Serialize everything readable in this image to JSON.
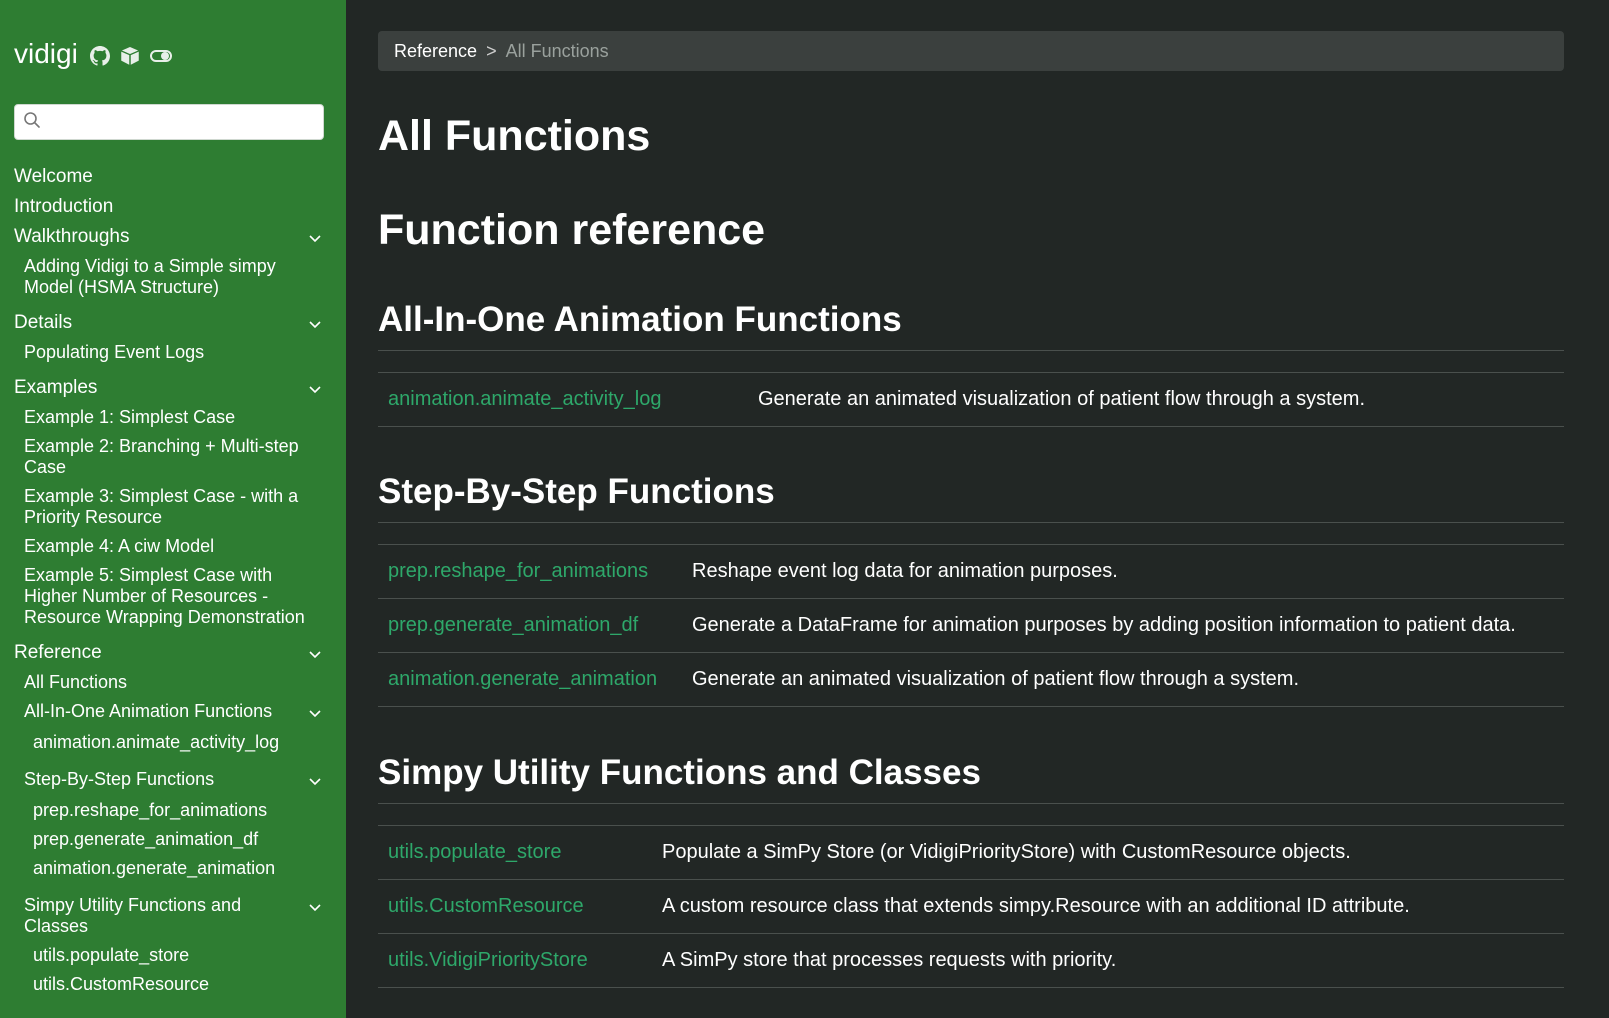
{
  "sidebar": {
    "brand": "vidigi",
    "icons": [
      "github-icon",
      "package-icon",
      "toggle-icon"
    ],
    "search": {
      "value": "",
      "placeholder": ""
    },
    "items": [
      {
        "label": "Welcome"
      },
      {
        "label": "Introduction"
      },
      {
        "label": "Walkthroughs"
      },
      {
        "label": "Adding Vidigi to a Simple simpy Model (HSMA Structure)"
      },
      {
        "label": "Details"
      },
      {
        "label": "Populating Event Logs"
      },
      {
        "label": "Examples"
      },
      {
        "label": "Example 1: Simplest Case"
      },
      {
        "label": "Example 2: Branching + Multi-step Case"
      },
      {
        "label": "Example 3: Simplest Case - with a Priority Resource"
      },
      {
        "label": "Example 4: A ciw Model"
      },
      {
        "label": "Example 5: Simplest Case with Higher Number of Resources - Resource Wrapping Demonstration"
      },
      {
        "label": "Reference"
      },
      {
        "label": "All Functions"
      },
      {
        "label": "All-In-One Animation Functions"
      },
      {
        "label": "animation.animate_activity_log"
      },
      {
        "label": "Step-By-Step Functions"
      },
      {
        "label": "prep.reshape_for_animations"
      },
      {
        "label": "prep.generate_animation_df"
      },
      {
        "label": "animation.generate_animation"
      },
      {
        "label": "Simpy Utility Functions and Classes"
      },
      {
        "label": "utils.populate_store"
      },
      {
        "label": "utils.CustomResource"
      }
    ]
  },
  "breadcrumb": {
    "parent": "Reference",
    "separator": ">",
    "current": "All Functions"
  },
  "main": {
    "title": "All Functions",
    "subtitle": "Function reference",
    "sections": [
      {
        "heading": "All-In-One Animation Functions",
        "rows": [
          {
            "name": "animation.animate_activity_log",
            "desc": "Generate an animated visualization of patient flow through a system."
          }
        ]
      },
      {
        "heading": "Step-By-Step Functions",
        "rows": [
          {
            "name": "prep.reshape_for_animations",
            "desc": "Reshape event log data for animation purposes."
          },
          {
            "name": "prep.generate_animation_df",
            "desc": "Generate a DataFrame for animation purposes by adding position information to patient data."
          },
          {
            "name": "animation.generate_animation",
            "desc": "Generate an animated visualization of patient flow through a system."
          }
        ]
      },
      {
        "heading": "Simpy Utility Functions and Classes",
        "rows": [
          {
            "name": "utils.populate_store",
            "desc": "Populate a SimPy Store (or VidigiPriorityStore) with CustomResource objects."
          },
          {
            "name": "utils.CustomResource",
            "desc": "A custom resource class that extends simpy.Resource with an additional ID attribute."
          },
          {
            "name": "utils.VidigiPriorityStore",
            "desc": "A SimPy store that processes requests with priority."
          }
        ]
      }
    ]
  },
  "colors": {
    "sidebar": "#2e7d32",
    "background": "#222725",
    "link": "#2ea86a",
    "breadcrumb_bg": "#3b403e"
  }
}
